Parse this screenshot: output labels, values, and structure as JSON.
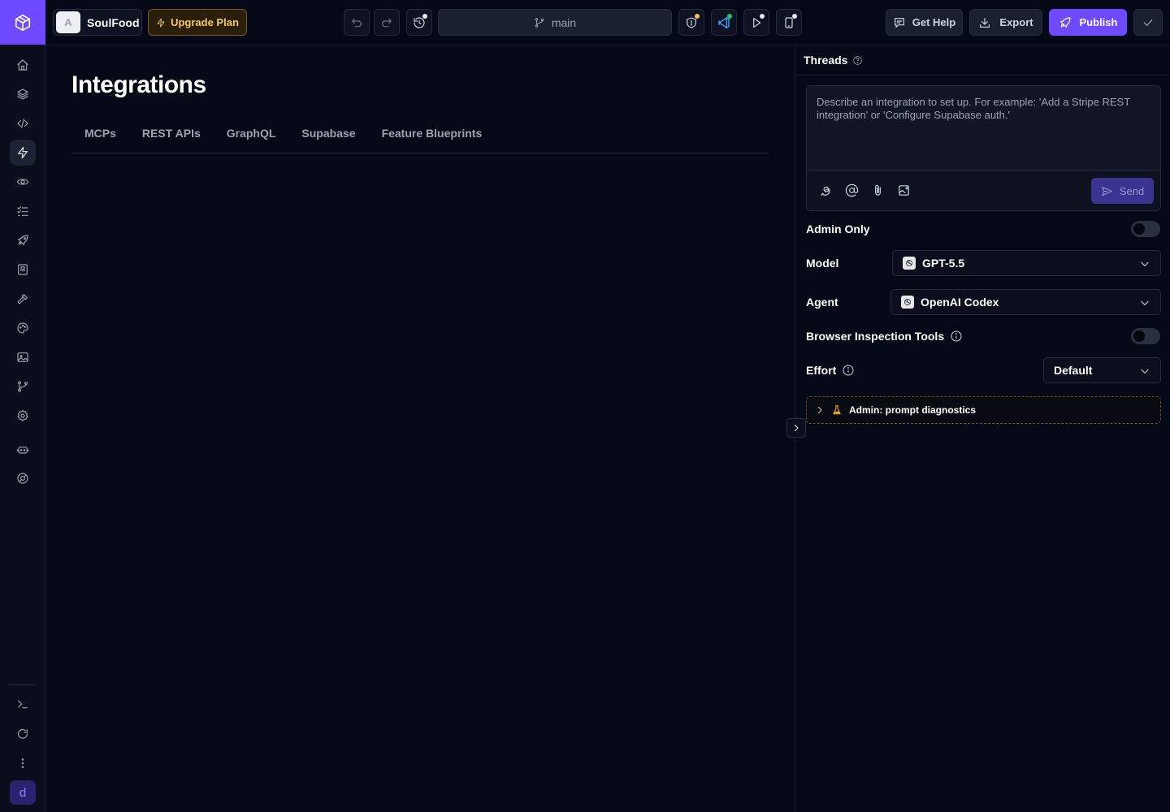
{
  "rail": {
    "items": [
      {
        "icon": "home-icon",
        "name": "rail-home"
      },
      {
        "icon": "layers-icon",
        "name": "rail-layers"
      },
      {
        "icon": "code-icon",
        "name": "rail-code"
      },
      {
        "icon": "lightning-icon",
        "name": "rail-integrations",
        "active": true
      },
      {
        "icon": "eye-icon",
        "name": "rail-preview"
      },
      {
        "icon": "checklist-icon",
        "name": "rail-tasks"
      },
      {
        "icon": "rocket-icon",
        "name": "rail-deploy"
      },
      {
        "icon": "book-icon",
        "name": "rail-docs"
      },
      {
        "icon": "hammer-icon",
        "name": "rail-build"
      },
      {
        "icon": "palette-icon",
        "name": "rail-theme"
      },
      {
        "icon": "image-icon",
        "name": "rail-assets"
      },
      {
        "icon": "git-branch-icon",
        "name": "rail-git"
      },
      {
        "icon": "settings-icon",
        "name": "rail-settings"
      },
      {
        "icon": "bot-icon",
        "name": "rail-agents"
      },
      {
        "icon": "support-icon",
        "name": "rail-support"
      }
    ],
    "bottom": [
      {
        "icon": "terminal-icon",
        "name": "rail-terminal"
      },
      {
        "icon": "refresh-icon",
        "name": "rail-refresh"
      },
      {
        "icon": "more-vertical-icon",
        "name": "rail-more"
      }
    ],
    "avatar_initial": "d"
  },
  "topbar": {
    "project_avatar": "A",
    "project_name": "SoulFood",
    "upgrade_label": "Upgrade Plan",
    "branch_name": "main",
    "get_help_label": "Get Help",
    "export_label": "Export",
    "publish_label": "Publish",
    "colors": {
      "accent": "#6d4aff",
      "upgrade": "#f3c969",
      "dot_yellow": "#f5c542",
      "dot_green": "#22c55e",
      "dot_white": "#e5e7eb"
    }
  },
  "main": {
    "title": "Integrations",
    "tabs": [
      "MCPs",
      "REST APIs",
      "GraphQL",
      "Supabase",
      "Feature Blueprints"
    ]
  },
  "threads": {
    "title": "Threads",
    "composer_placeholder": "Describe an integration to set up. For example: 'Add a Stripe REST integration' or 'Configure Supabase auth.'",
    "send_label": "Send",
    "admin_only_label": "Admin Only",
    "admin_only_on": false,
    "model_label": "Model",
    "model_value": "GPT-5.5",
    "agent_label": "Agent",
    "agent_value": "OpenAI Codex",
    "browser_tools_label": "Browser Inspection Tools",
    "browser_tools_on": false,
    "effort_label": "Effort",
    "effort_value": "Default",
    "diagnostics_label": "Admin: prompt diagnostics"
  }
}
